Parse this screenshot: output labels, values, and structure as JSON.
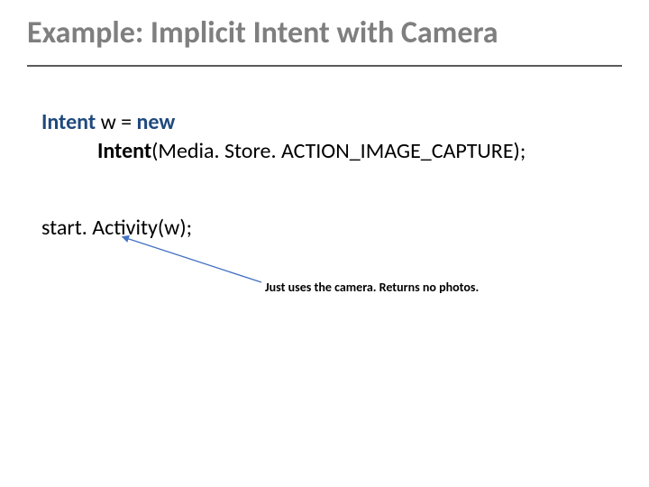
{
  "title": "Example: Implicit Intent with Camera",
  "code": {
    "kw_intent1": "Intent",
    "var_w_eq": " w = ",
    "kw_new": "new",
    "kw_intent2": "Intent",
    "call_args": "(Media. Store. ACTION_IMAGE_CAPTURE); "
  },
  "stmt2": "start. Activity(w); ",
  "annotation": "Just uses the camera. Returns no photos.",
  "arrow_color": "#4472c4"
}
